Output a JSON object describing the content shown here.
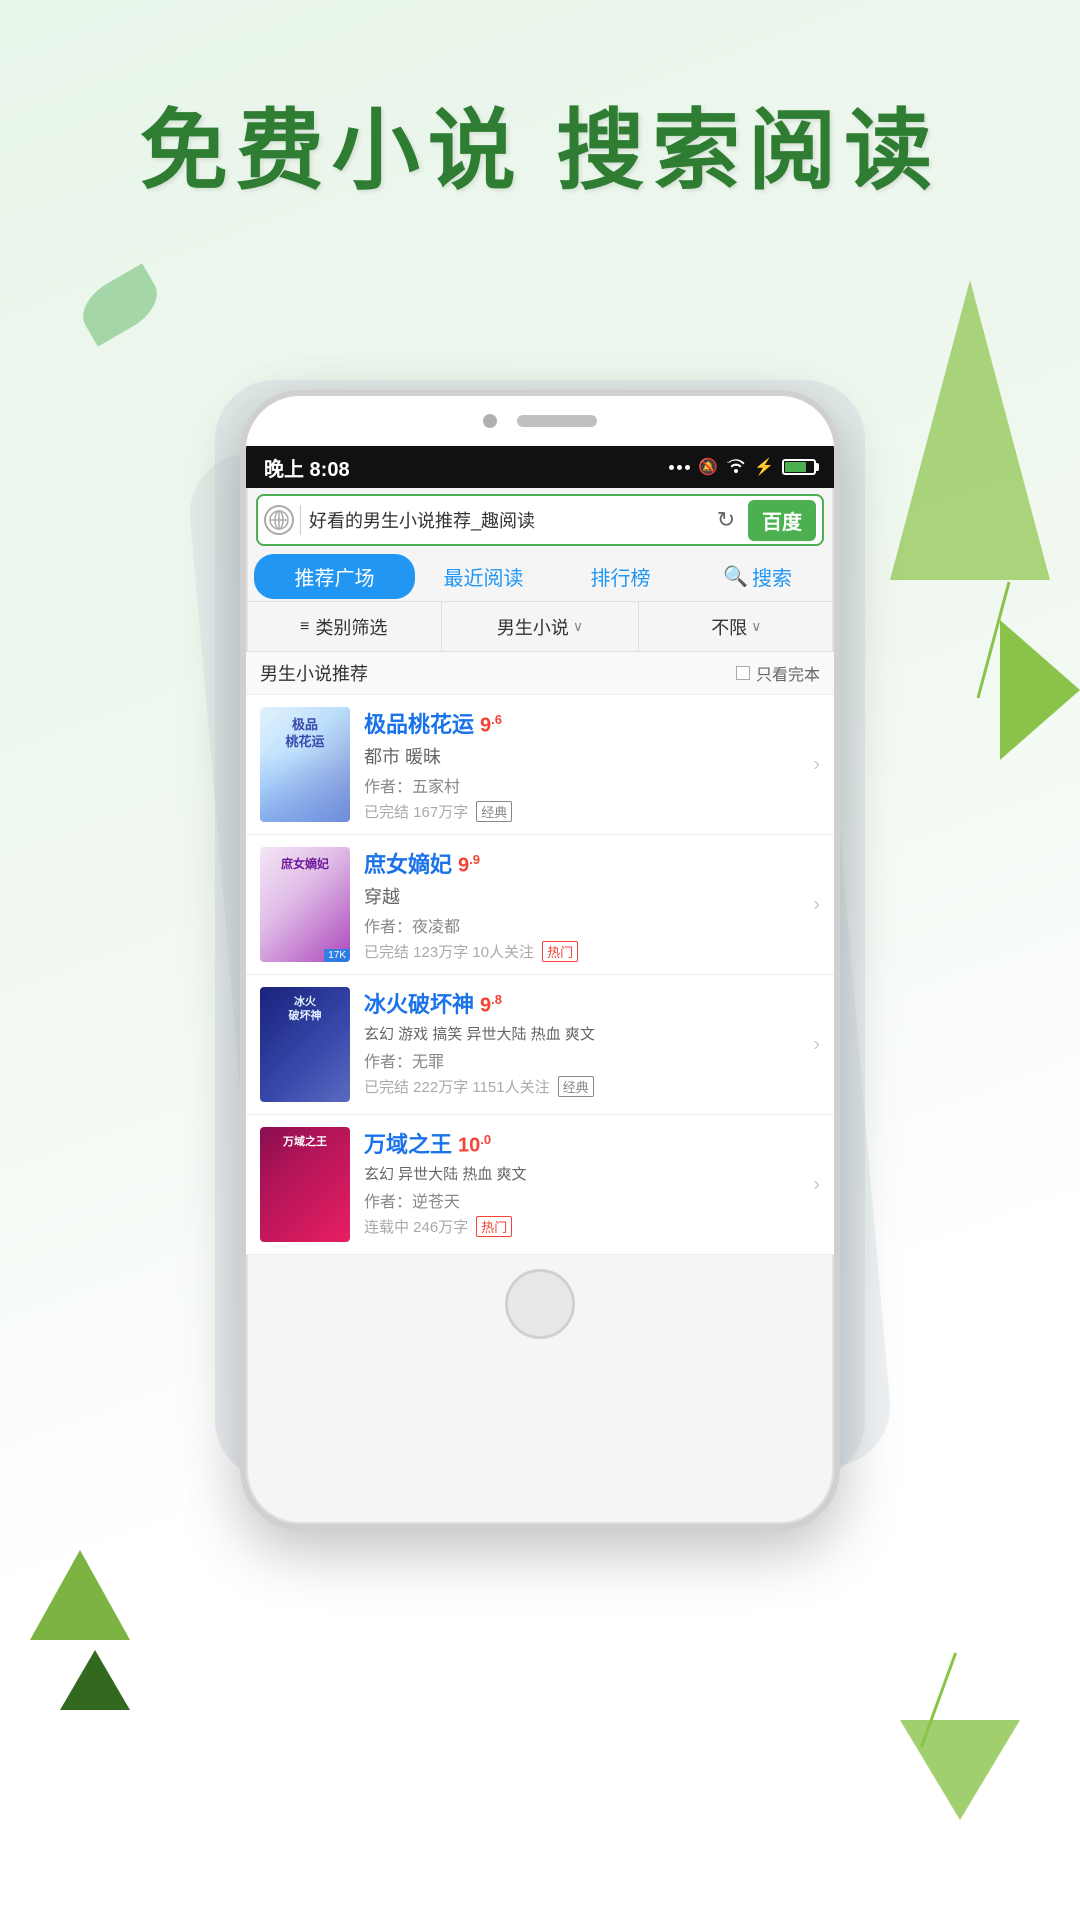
{
  "headline": {
    "line1": "免费小说  搜索阅读"
  },
  "phone": {
    "status_bar": {
      "time": "晚上 8:08",
      "signal": "...",
      "mute": "🔕",
      "wifi": "WiFi",
      "charge": "⚡"
    },
    "browser": {
      "url": "好看的男生小说推荐_趣阅读",
      "search_button": "百度",
      "refresh_icon": "↻"
    },
    "tabs": [
      {
        "label": "推荐广场",
        "active": true
      },
      {
        "label": "最近阅读",
        "active": false
      },
      {
        "label": "排行榜",
        "active": false
      },
      {
        "label": "搜索",
        "active": false
      }
    ],
    "filters": [
      {
        "label": "类别筛选",
        "icon": "≡"
      },
      {
        "label": "男生小说",
        "chevron": "∨"
      },
      {
        "label": "不限",
        "chevron": "∨"
      }
    ],
    "section": {
      "title": "男生小说推荐",
      "only_complete_label": "只看完本"
    },
    "books": [
      {
        "title": "极品桃花运",
        "rating": "9",
        "rating_sup": ".6",
        "genre": "都市 暖昧",
        "author": "作者：五家村",
        "meta": "已完结 167万字",
        "badge": "经典",
        "badge_type": "classic",
        "cover_class": "cover-1",
        "cover_label": "极品\n桃花运"
      },
      {
        "title": "庶女嫡妃",
        "rating": "9",
        "rating_sup": ".9",
        "genre": "穿越",
        "author": "作者：夜凌都",
        "meta": "已完结 123万字 10人关注",
        "badge": "热门",
        "badge_type": "hot",
        "cover_class": "cover-2",
        "cover_label": "庶女嫡妃",
        "cover_badge": "17K"
      },
      {
        "title": "冰火破坏神",
        "rating": "9",
        "rating_sup": ".8",
        "genre": "玄幻 游戏 搞笑 异世大陆 热血 爽文",
        "author": "作者：无罪",
        "meta": "已完结 222万字 1151人关注",
        "badge": "经典",
        "badge_type": "classic",
        "cover_class": "cover-3",
        "cover_label": "冰火破坏神"
      },
      {
        "title": "万域之王",
        "rating": "10",
        "rating_sup": ".0",
        "genre": "玄幻 异世大陆 热血 爽文",
        "author": "作者：逆苍天",
        "meta": "连载中 246万字",
        "badge": "热门",
        "badge_type": "hot",
        "cover_class": "cover-4",
        "cover_label": "万域之王"
      }
    ]
  }
}
